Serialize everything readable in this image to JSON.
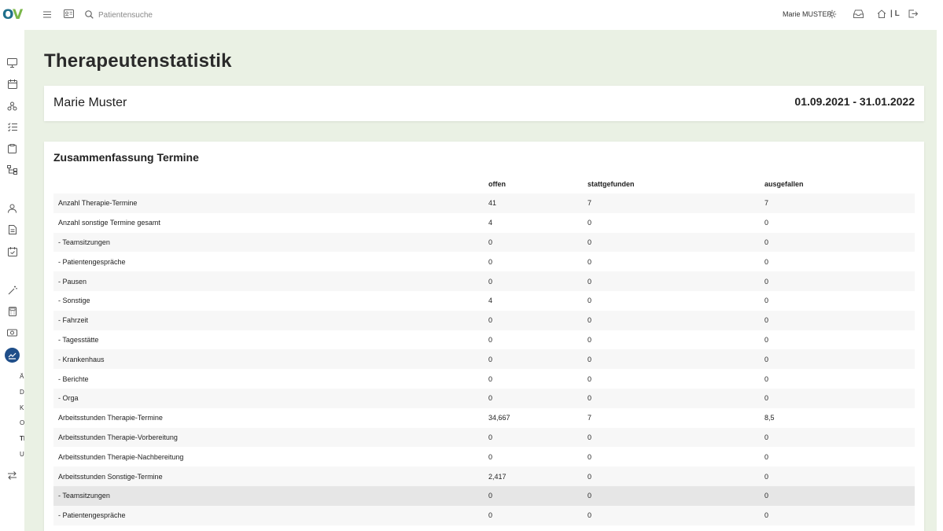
{
  "app": {
    "logo_o": "O",
    "logo_v": "V"
  },
  "topbar": {
    "search_placeholder": "Patientensuche",
    "user_name": "Marie MUSTER",
    "home_suffix": "| L"
  },
  "sidebar": {
    "letters": [
      {
        "text": "Ä",
        "bold": false
      },
      {
        "text": "D",
        "bold": false
      },
      {
        "text": "K",
        "bold": false
      },
      {
        "text": "O",
        "bold": false
      },
      {
        "text": "Th",
        "bold": true
      },
      {
        "text": "U",
        "bold": false
      }
    ]
  },
  "page": {
    "title": "Therapeutenstatistik",
    "therapist_name": "Marie Muster",
    "date_range": "01.09.2021 - 31.01.2022"
  },
  "summary": {
    "title": "Zusammenfassung Termine",
    "columns": [
      "",
      "offen",
      "stattgefunden",
      "ausgefallen"
    ],
    "rows": [
      {
        "label": "Anzahl Therapie-Termine",
        "offen": "41",
        "stattgefunden": "7",
        "ausgefallen": "7"
      },
      {
        "label": "Anzahl sonstige Termine gesamt",
        "offen": "4",
        "stattgefunden": "0",
        "ausgefallen": "0"
      },
      {
        "label": "- Teamsitzungen",
        "offen": "0",
        "stattgefunden": "0",
        "ausgefallen": "0"
      },
      {
        "label": "- Patientengespräche",
        "offen": "0",
        "stattgefunden": "0",
        "ausgefallen": "0"
      },
      {
        "label": "- Pausen",
        "offen": "0",
        "stattgefunden": "0",
        "ausgefallen": "0"
      },
      {
        "label": "- Sonstige",
        "offen": "4",
        "stattgefunden": "0",
        "ausgefallen": "0"
      },
      {
        "label": "- Fahrzeit",
        "offen": "0",
        "stattgefunden": "0",
        "ausgefallen": "0"
      },
      {
        "label": "- Tagesstätte",
        "offen": "0",
        "stattgefunden": "0",
        "ausgefallen": "0"
      },
      {
        "label": "- Krankenhaus",
        "offen": "0",
        "stattgefunden": "0",
        "ausgefallen": "0"
      },
      {
        "label": "- Berichte",
        "offen": "0",
        "stattgefunden": "0",
        "ausgefallen": "0"
      },
      {
        "label": "- Orga",
        "offen": "0",
        "stattgefunden": "0",
        "ausgefallen": "0"
      },
      {
        "label": "Arbeitsstunden Therapie-Termine",
        "offen": "34,667",
        "stattgefunden": "7",
        "ausgefallen": "8,5"
      },
      {
        "label": "Arbeitsstunden Therapie-Vorbereitung",
        "offen": "0",
        "stattgefunden": "0",
        "ausgefallen": "0"
      },
      {
        "label": "Arbeitsstunden Therapie-Nachbereitung",
        "offen": "0",
        "stattgefunden": "0",
        "ausgefallen": "0"
      },
      {
        "label": "Arbeitsstunden Sonstige-Termine",
        "offen": "2,417",
        "stattgefunden": "0",
        "ausgefallen": "0"
      },
      {
        "label": "- Teamsitzungen",
        "offen": "0",
        "stattgefunden": "0",
        "ausgefallen": "0",
        "highlight": true
      },
      {
        "label": "- Patientengespräche",
        "offen": "0",
        "stattgefunden": "0",
        "ausgefallen": "0"
      }
    ]
  },
  "colors": {
    "main_bg": "#eaf1e4",
    "logo_blue": "#1f6f8b",
    "logo_green": "#7ab648",
    "active_nav": "#1f4e89"
  }
}
